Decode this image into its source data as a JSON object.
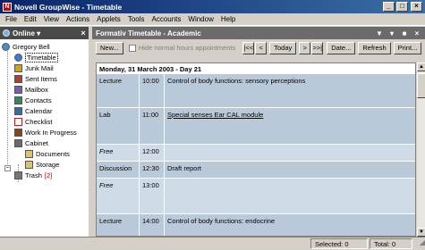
{
  "window": {
    "title": "Novell GroupWise - Timetable"
  },
  "menu": [
    "File",
    "Edit",
    "View",
    "Actions",
    "Applets",
    "Tools",
    "Accounts",
    "Window",
    "Help"
  ],
  "left_pane": {
    "mode": "Online",
    "user": "Gregory Bell",
    "items": [
      {
        "label": "Timetable",
        "icon": "calendar-icon",
        "color": "#3a7bd5"
      },
      {
        "label": "Junk Mail",
        "icon": "junk-mail-icon",
        "color": "#d9a400"
      },
      {
        "label": "Sent Items",
        "icon": "sent-items-icon",
        "color": "#c0392b"
      },
      {
        "label": "Mailbox",
        "icon": "mailbox-icon",
        "color": "#7a5ab8"
      },
      {
        "label": "Contacts",
        "icon": "contacts-icon",
        "color": "#2e8b57"
      },
      {
        "label": "Calendar",
        "icon": "calendar-icon",
        "color": "#2e6db4"
      },
      {
        "label": "Checklist",
        "icon": "checklist-icon",
        "color": "#b22222"
      },
      {
        "label": "Work In Progress",
        "icon": "work-in-progress-icon",
        "color": "#8b4513"
      },
      {
        "label": "Cabinet",
        "icon": "cabinet-icon",
        "color": "#6b6b6b"
      },
      {
        "label": "Documents",
        "icon": "folder-icon",
        "color": "#e2c35c"
      },
      {
        "label": "Storage",
        "icon": "folder-icon",
        "color": "#e2c35c"
      },
      {
        "label": "Trash",
        "icon": "trash-icon",
        "color": "#777777",
        "badge": "[2]"
      }
    ]
  },
  "right_pane": {
    "title": "Formativ Timetable - Academic",
    "toolbar": {
      "new": "New...",
      "hide_normal_hours": "Hide normal hours appointments",
      "first": "|<<",
      "prev": "<",
      "today": "Today",
      "next": ">",
      "last": ">>|",
      "date": "Date...",
      "refresh": "Refresh",
      "print": "Print..."
    },
    "day_heading": "Monday, 31 March 2003 - Day 21",
    "slots": [
      {
        "type": "Lecture",
        "time": "10:00",
        "subject": "Control of body functions: sensory perceptions",
        "free": false,
        "link": false
      },
      {
        "type": "Lab",
        "time": "11:00",
        "subject": "Special senses Ear CAL module",
        "free": false,
        "link": true
      },
      {
        "type": "Free",
        "time": "12:00",
        "subject": "",
        "free": true,
        "link": false
      },
      {
        "type": "Discussion",
        "time": "12:30",
        "subject": "Draft report",
        "free": false,
        "link": false
      },
      {
        "type": "Free",
        "time": "13:00",
        "subject": "",
        "free": true,
        "link": false
      },
      {
        "type": "Lecture",
        "time": "14:00",
        "subject": "Control of body functions: endocrine",
        "free": false,
        "link": false
      }
    ]
  },
  "status": {
    "selected": "Selected: 0",
    "total": "Total: 0"
  }
}
